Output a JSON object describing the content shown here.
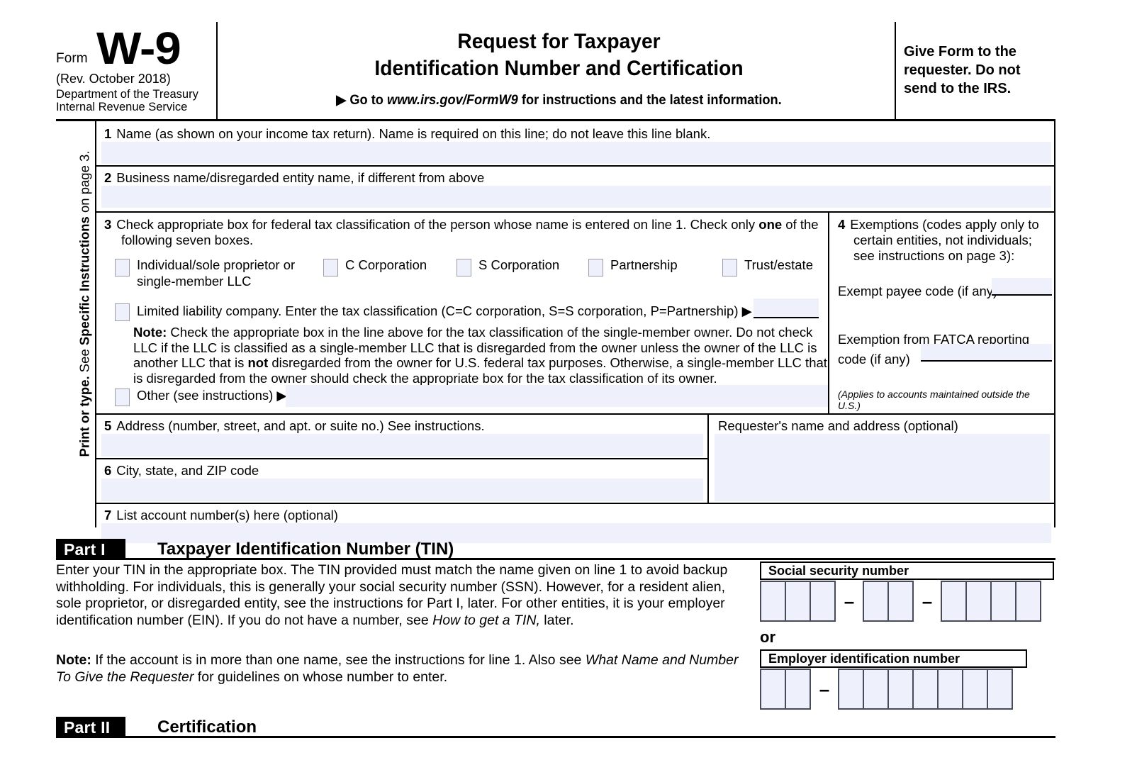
{
  "header": {
    "form_word": "Form",
    "form_number": "W-9",
    "revision": "(Rev. October 2018)",
    "department_line1": "Department of the Treasury",
    "department_line2": "Internal Revenue Service",
    "title_line1": "Request for Taxpayer",
    "title_line2": "Identification Number and Certification",
    "goto_prefix": "▶ Go to ",
    "goto_url": "www.irs.gov/FormW9",
    "goto_suffix": " for instructions and the latest information.",
    "give_form_note": "Give Form to the requester. Do not send to the IRS."
  },
  "sidebar": {
    "line1": "Print or type.",
    "line2_prefix": "See ",
    "line2_bold": "Specific Instructions",
    "line2_suffix": " on page 3."
  },
  "line1": {
    "number": "1",
    "label": "Name (as shown on your income tax return). Name is required on this line; do not leave this line blank.",
    "value": ""
  },
  "line2": {
    "number": "2",
    "label": "Business name/disregarded entity name, if different from above",
    "value": ""
  },
  "line3": {
    "number": "3",
    "heading_a": "Check appropriate box for federal tax classification of the person whose name is entered on line 1. Check only ",
    "heading_bold": "one",
    "heading_b": " of the following seven boxes.",
    "checkboxes": [
      {
        "name": "individual-sole-proprietor",
        "label_line1": "Individual/sole proprietor or",
        "label_line2": "single-member LLC",
        "checked": false
      },
      {
        "name": "c-corporation",
        "label_line1": "C Corporation",
        "label_line2": "",
        "checked": false
      },
      {
        "name": "s-corporation",
        "label_line1": "S Corporation",
        "label_line2": "",
        "checked": false
      },
      {
        "name": "partnership",
        "label_line1": "Partnership",
        "label_line2": "",
        "checked": false
      },
      {
        "name": "trust-estate",
        "label_line1": "Trust/estate",
        "label_line2": "",
        "checked": false
      }
    ],
    "llc_label": "Limited liability company. Enter the tax classification (C=C corporation, S=S corporation, P=Partnership) ▶",
    "llc_value": "",
    "note_bold": "Note:",
    "note_text_1": " Check the appropriate box in the line above for the tax classification of the single-member owner.  Do not check LLC if the LLC is classified as a single-member LLC that is disregarded from the owner unless the owner of the LLC is another LLC that is ",
    "note_bold_2": "not",
    "note_text_2": " disregarded from the owner for U.S. federal tax purposes. Otherwise, a single-member LLC that is disregarded from the owner should check the appropriate box for the tax classification of its owner.",
    "other_label": "Other (see instructions) ▶",
    "other_value": ""
  },
  "line4": {
    "number": "4",
    "heading": "Exemptions (codes apply only to certain entities, not individuals; see instructions on page 3):",
    "exempt_payee_label": "Exempt payee code (if any)",
    "exempt_payee_value": "",
    "fatca_label_line1": "Exemption from FATCA reporting",
    "fatca_label_line2": "code (if any)",
    "fatca_value": "",
    "footnote": "(Applies to accounts maintained outside the U.S.)"
  },
  "line5": {
    "number": "5",
    "label": "Address (number, street, and apt. or suite no.) See instructions.",
    "value": ""
  },
  "line6": {
    "number": "6",
    "label": "City, state, and ZIP code",
    "value": ""
  },
  "line7": {
    "number": "7",
    "label": "List account number(s) here (optional)",
    "value": ""
  },
  "requester": {
    "label": "Requester's name and address (optional)",
    "value": ""
  },
  "part1": {
    "tag": "Part I",
    "title": "Taxpayer Identification Number (TIN)",
    "body_1": "Enter your TIN in the appropriate box. The TIN provided must match the name given on line 1 to avoid backup withholding. For individuals, this is generally your social security number (SSN). However, for a resident alien, sole proprietor, or disregarded entity, see the instructions for Part I, later. For other entities, it is your employer identification number (EIN). If you do not have a number, see ",
    "body_1_italic": "How to get a TIN,",
    "body_1_tail": " later.",
    "note_bold": "Note:",
    "note_text": " If the account is in more than one name, see the instructions for line 1. Also see ",
    "note_italic": "What Name and Number To Give the Requester",
    "note_tail": " for guidelines on whose number to enter.",
    "ssn": {
      "caption": "Social security number",
      "groups": [
        3,
        2,
        4
      ],
      "separator": "–",
      "digits": ""
    },
    "or_label": "or",
    "ein": {
      "caption": "Employer identification number",
      "groups": [
        2,
        7
      ],
      "separator": "–",
      "digits": ""
    }
  },
  "part2": {
    "tag": "Part II",
    "title": "Certification"
  },
  "colors": {
    "field_fill": "#eef0fb",
    "checkbox_border": "#9b9dae",
    "tin_cell_border": "#474b5e",
    "rule": "#000000"
  }
}
